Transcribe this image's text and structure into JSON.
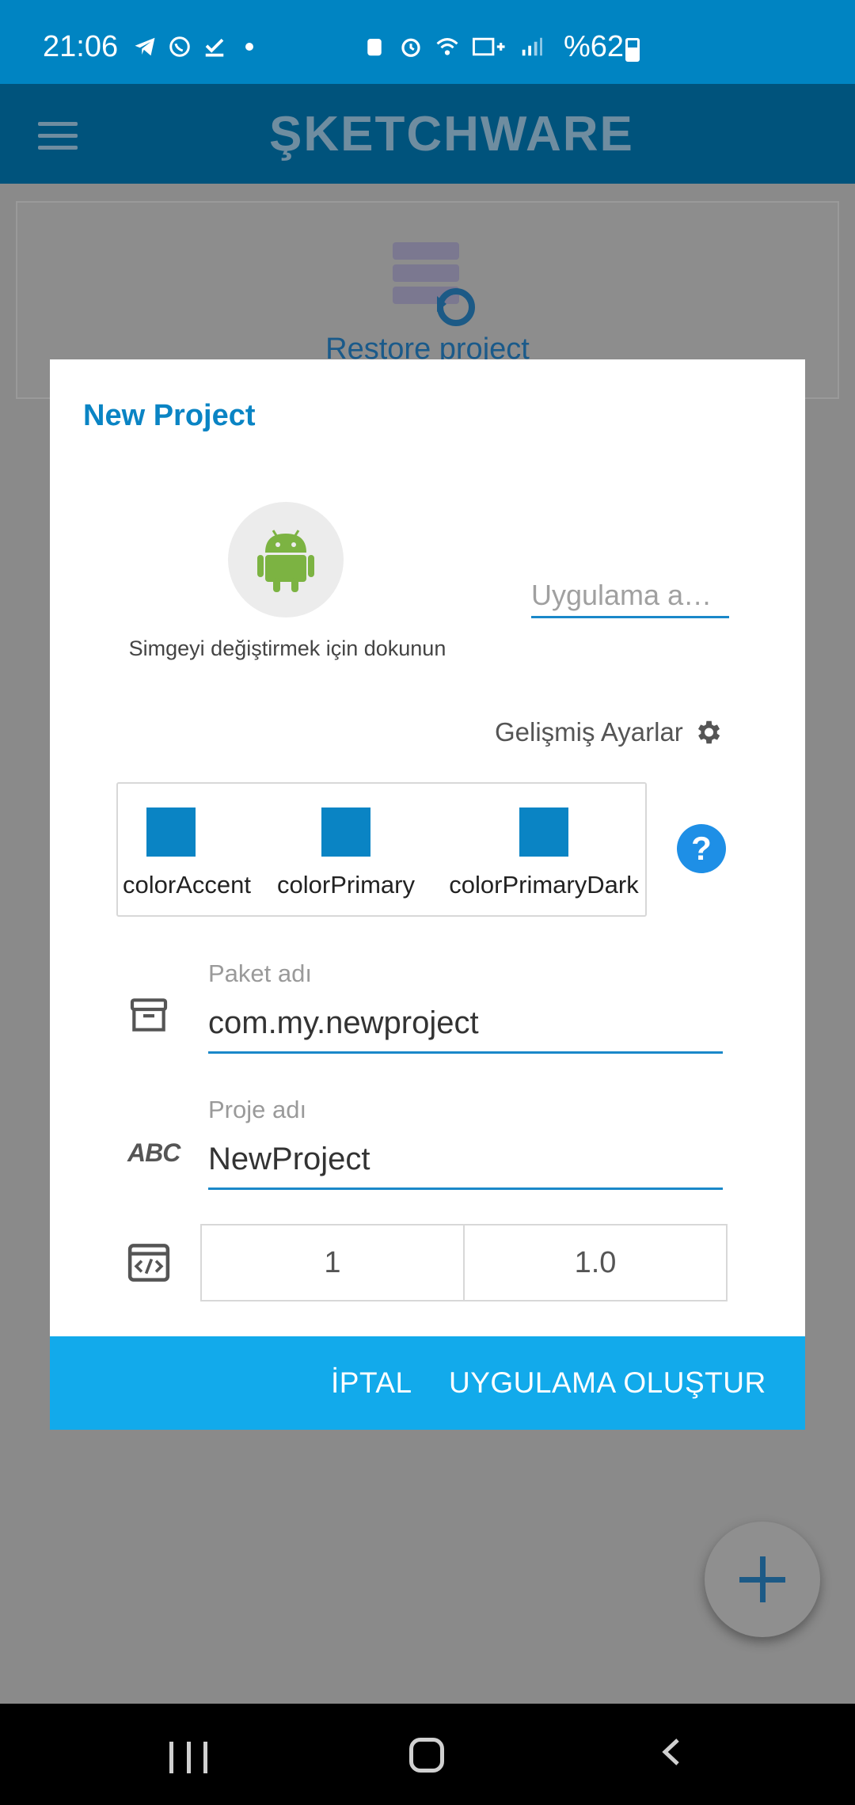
{
  "status_bar": {
    "time": "21:06",
    "battery": "%62",
    "icons": [
      "telegram-icon",
      "whatsapp-icon",
      "check-icon",
      "dot-icon",
      "recycle-icon",
      "alarm-icon",
      "wifi-icon",
      "lte-icon",
      "signal-icon",
      "battery-icon"
    ]
  },
  "app_bar": {
    "logo": "ŞKETCHWARE"
  },
  "background": {
    "restore_label": "Restore project"
  },
  "dialog": {
    "title": "New Project",
    "icon_hint": "Simgeyi değiştirmek için dokunun",
    "app_name_placeholder": "Uygulama a…",
    "advanced_settings": "Gelişmiş Ayarlar",
    "colors": [
      {
        "label": "colorAccent",
        "color": "#0a84c4"
      },
      {
        "label": "colorPrimary",
        "color": "#0a84c4"
      },
      {
        "label": "colorPrimaryDark",
        "color": "#0a84c4"
      }
    ],
    "help_label": "?",
    "package": {
      "label": "Paket adı",
      "value": "com.my.newproject"
    },
    "project": {
      "label": "Proje adı",
      "value": "NewProject"
    },
    "abc_label": "ABC",
    "version_code": "1",
    "version_name": "1.0",
    "cancel_label": "İPTAL",
    "create_label": "UYGULAMA OLUŞTUR"
  },
  "colors": {
    "accent": "#0a84c4",
    "footer": "#12aaeb",
    "status_bar": "#0084c2"
  }
}
